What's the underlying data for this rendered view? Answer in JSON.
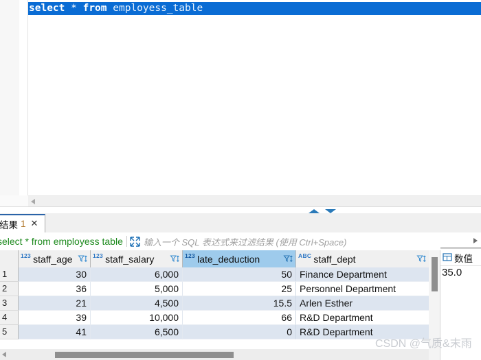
{
  "editor": {
    "sql_keyword_1": "select",
    "sql_star": "*",
    "sql_keyword_2": "from",
    "sql_table": "employess_table",
    "full_statement": "select * from employess_table",
    "selection_color": "#0a6cd4"
  },
  "results": {
    "tab": {
      "label": "结果",
      "number": "1",
      "close": "✕"
    },
    "filter": {
      "query_text": "select * from employess  table",
      "query_color": "#1d8a1d",
      "placeholder": "输入一个 SQL 表达式来过滤结果 (使用 Ctrl+Space)",
      "expand_icon": "expand-arrows-icon"
    },
    "grid": {
      "columns": [
        {
          "name": "staff_age",
          "type_badge": "123",
          "align": "num",
          "selected": false
        },
        {
          "name": "staff_salary",
          "type_badge": "123",
          "align": "num",
          "selected": false
        },
        {
          "name": "late_deduction",
          "type_badge": "123",
          "align": "num",
          "selected": true
        },
        {
          "name": "staff_dept",
          "type_badge": "ABC",
          "align": "txt",
          "selected": false
        }
      ],
      "rows": [
        {
          "n": "1",
          "staff_age": "30",
          "staff_salary": "6,000",
          "late_deduction": "50",
          "staff_dept": "Finance Department"
        },
        {
          "n": "2",
          "staff_age": "36",
          "staff_salary": "5,000",
          "late_deduction": "25",
          "staff_dept": "Personnel Department"
        },
        {
          "n": "3",
          "staff_age": "21",
          "staff_salary": "4,500",
          "late_deduction": "15.5",
          "staff_dept": " Arlen Esther"
        },
        {
          "n": "4",
          "staff_age": "39",
          "staff_salary": "10,000",
          "late_deduction": "66",
          "staff_dept": "R&D Department"
        },
        {
          "n": "5",
          "staff_age": "41",
          "staff_salary": "6,500",
          "late_deduction": "0",
          "staff_dept": "R&D Department"
        }
      ]
    },
    "value_panel": {
      "title": "数值",
      "value": "35.0",
      "icon": "grid-value-icon"
    }
  },
  "watermark": "CSDN @气质&末雨"
}
